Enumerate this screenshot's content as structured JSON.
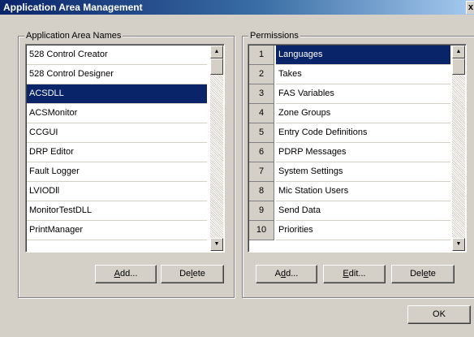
{
  "window": {
    "title": "Application Area Management",
    "close_glyph": "x"
  },
  "app_areas": {
    "legend": "Application Area Names",
    "items": [
      "528 Control Creator",
      "528 Control Designer",
      "ACSDLL",
      "ACSMonitor",
      "CCGUI",
      "DRP Editor",
      "Fault Logger",
      "LVIODll",
      "MonitorTestDLL",
      "PrintManager"
    ],
    "selected_index": 2,
    "add_label": {
      "pre": "",
      "key": "A",
      "post": "dd..."
    },
    "delete_label": {
      "pre": "De",
      "key": "l",
      "post": "ete"
    }
  },
  "permissions": {
    "legend": "Permissions",
    "items": [
      {
        "num": "1",
        "name": "Languages"
      },
      {
        "num": "2",
        "name": "Takes"
      },
      {
        "num": "3",
        "name": "FAS Variables"
      },
      {
        "num": "4",
        "name": "Zone Groups"
      },
      {
        "num": "5",
        "name": "Entry Code Definitions"
      },
      {
        "num": "6",
        "name": "PDRP Messages"
      },
      {
        "num": "7",
        "name": "System Settings"
      },
      {
        "num": "8",
        "name": "Mic Station Users"
      },
      {
        "num": "9",
        "name": "Send Data"
      },
      {
        "num": "10",
        "name": "Priorities"
      }
    ],
    "selected_index": 0,
    "add_label": {
      "pre": "A",
      "key": "d",
      "post": "d..."
    },
    "edit_label": {
      "pre": "",
      "key": "E",
      "post": "dit..."
    },
    "delete_label": {
      "pre": "Del",
      "key": "e",
      "post": "te"
    }
  },
  "ok_label": "OK",
  "icons": {
    "scroll_up": "▲",
    "scroll_down": "▼"
  },
  "colors": {
    "selection": "#0a246a",
    "face": "#d4d0c8"
  }
}
